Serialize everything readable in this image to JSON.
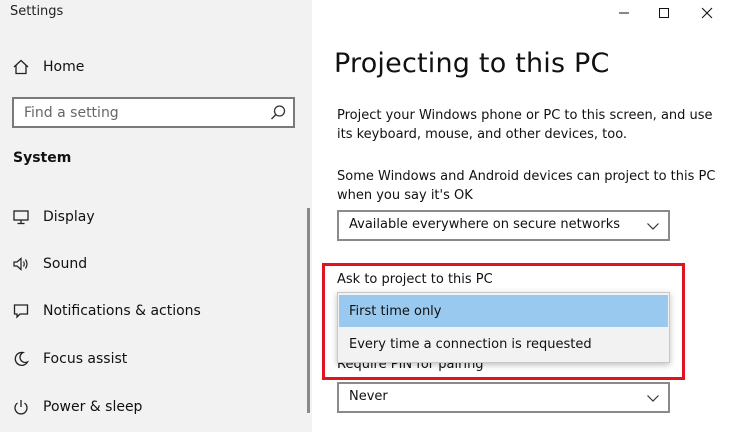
{
  "window": {
    "app_title": "Settings"
  },
  "sidebar": {
    "home_label": "Home",
    "search_placeholder": "Find a setting",
    "section_header": "System",
    "items": [
      {
        "label": "Display",
        "icon": "monitor-icon"
      },
      {
        "label": "Sound",
        "icon": "speaker-icon"
      },
      {
        "label": "Notifications & actions",
        "icon": "notification-icon"
      },
      {
        "label": "Focus assist",
        "icon": "moon-icon"
      },
      {
        "label": "Power & sleep",
        "icon": "power-icon"
      }
    ]
  },
  "main": {
    "title": "Projecting to this PC",
    "description": "Project your Windows phone or PC to this screen, and use its keyboard, mouse, and other devices, too.",
    "availability_text": "Some Windows and Android devices can project to this PC when you say it's OK",
    "availability_dropdown_value": "Available everywhere on secure networks",
    "ask_label": "Ask to project to this PC",
    "ask_options": [
      {
        "label": "First time only",
        "selected": true
      },
      {
        "label": "Every time a connection is requested",
        "selected": false
      }
    ],
    "pin_label": "Require PIN for pairing",
    "pin_dropdown_value": "Never"
  },
  "colors": {
    "highlight_border": "#e0141e",
    "selected_option": "#99c9ef",
    "sidebar_bg": "#f2f2f2"
  }
}
